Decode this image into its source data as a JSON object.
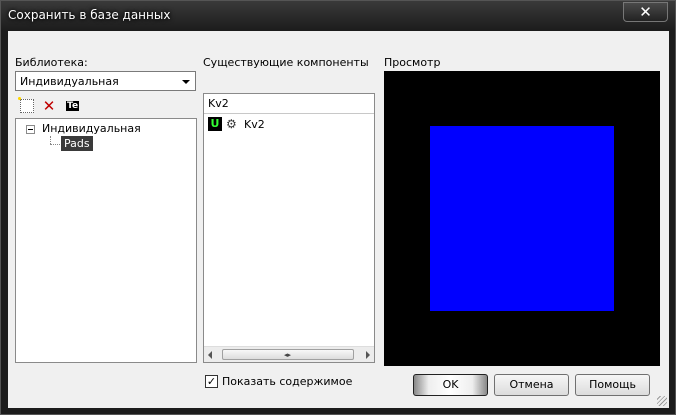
{
  "window": {
    "title": "Сохранить в базе данных",
    "close_glyph": "✕"
  },
  "library": {
    "label": "Библиотека:",
    "selected": "Индивидуальная",
    "toolbar": {
      "rename_text": "Te"
    },
    "tree": {
      "root": "Индивидуальная",
      "child": "Pads"
    }
  },
  "components": {
    "label": "Существующие компоненты",
    "filter_value": "Kv2",
    "items": [
      {
        "badge": "U",
        "name": "Kv2"
      }
    ]
  },
  "preview": {
    "label": "Просмотр",
    "background": "#000000",
    "shape_color": "#0000ff"
  },
  "show_contents": {
    "label": "Показать содержимое",
    "checked": true,
    "check_glyph": "✓"
  },
  "buttons": {
    "ok": "OK",
    "cancel": "Отмена",
    "help": "Помощь"
  }
}
